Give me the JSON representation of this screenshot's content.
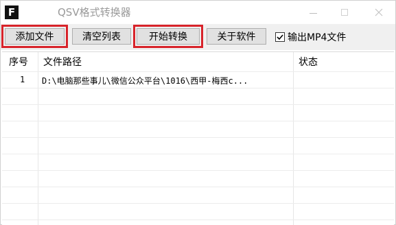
{
  "window": {
    "icon_letter": "F",
    "title": "QSV格式转换器"
  },
  "toolbar": {
    "add_file_label": "添加文件",
    "clear_list_label": "清空列表",
    "start_convert_label": "开始转换",
    "about_label": "关于软件",
    "output_mp4_label": "输出MP4文件",
    "output_mp4_checked": true,
    "highlight_color": "#d8232a"
  },
  "table": {
    "headers": [
      "序号",
      "文件路径",
      "状态"
    ],
    "rows": [
      {
        "index": "1",
        "path": "D:\\电脑那些事儿\\微信公众平台\\1016\\西甲-梅西c...",
        "status": ""
      }
    ]
  }
}
